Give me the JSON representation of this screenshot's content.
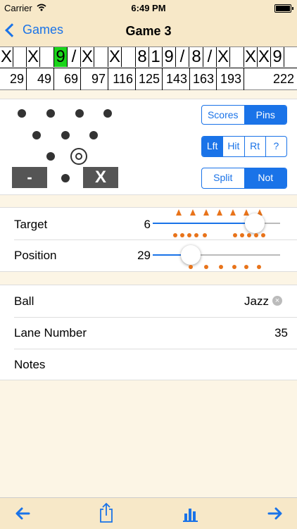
{
  "status": {
    "carrier": "Carrier",
    "time": "6:49 PM"
  },
  "nav": {
    "back_label": "Games",
    "title": "Game 3"
  },
  "scoreboard": {
    "throws": [
      "X",
      "X",
      "9",
      "/",
      "X",
      "X",
      "8",
      "1",
      "9",
      "/",
      "8",
      "/",
      "X",
      "X",
      "X",
      "9"
    ],
    "highlighted_throw_index": 2,
    "totals": [
      "29",
      "49",
      "69",
      "97",
      "116",
      "125",
      "143",
      "163",
      "193",
      "222"
    ]
  },
  "pin_panel": {
    "spare_button": "-",
    "strike_button": "X",
    "view_toggle": {
      "options": [
        "Scores",
        "Pins"
      ],
      "selected": "Pins"
    },
    "side_toggle": {
      "options": [
        "Lft",
        "Hit",
        "Rt",
        "?"
      ],
      "selected": "Lft"
    },
    "split_toggle": {
      "options": [
        "Split",
        "Not"
      ],
      "selected": "Not"
    }
  },
  "sliders": {
    "target": {
      "label": "Target",
      "value": "6",
      "fraction": 0.8
    },
    "position": {
      "label": "Position",
      "value": "29",
      "fraction": 0.3
    }
  },
  "details": {
    "ball": {
      "label": "Ball",
      "value": "Jazz"
    },
    "lane": {
      "label": "Lane Number",
      "value": "35"
    },
    "notes": {
      "label": "Notes"
    }
  },
  "colors": {
    "accent": "#1a73e8",
    "highlight": "#19d419",
    "marker": "#e8731a",
    "bar_bg": "#f7e8c8"
  },
  "icons": {
    "toolbar": [
      "left-arrow-icon",
      "share-icon",
      "bar-chart-icon",
      "right-arrow-icon"
    ]
  }
}
